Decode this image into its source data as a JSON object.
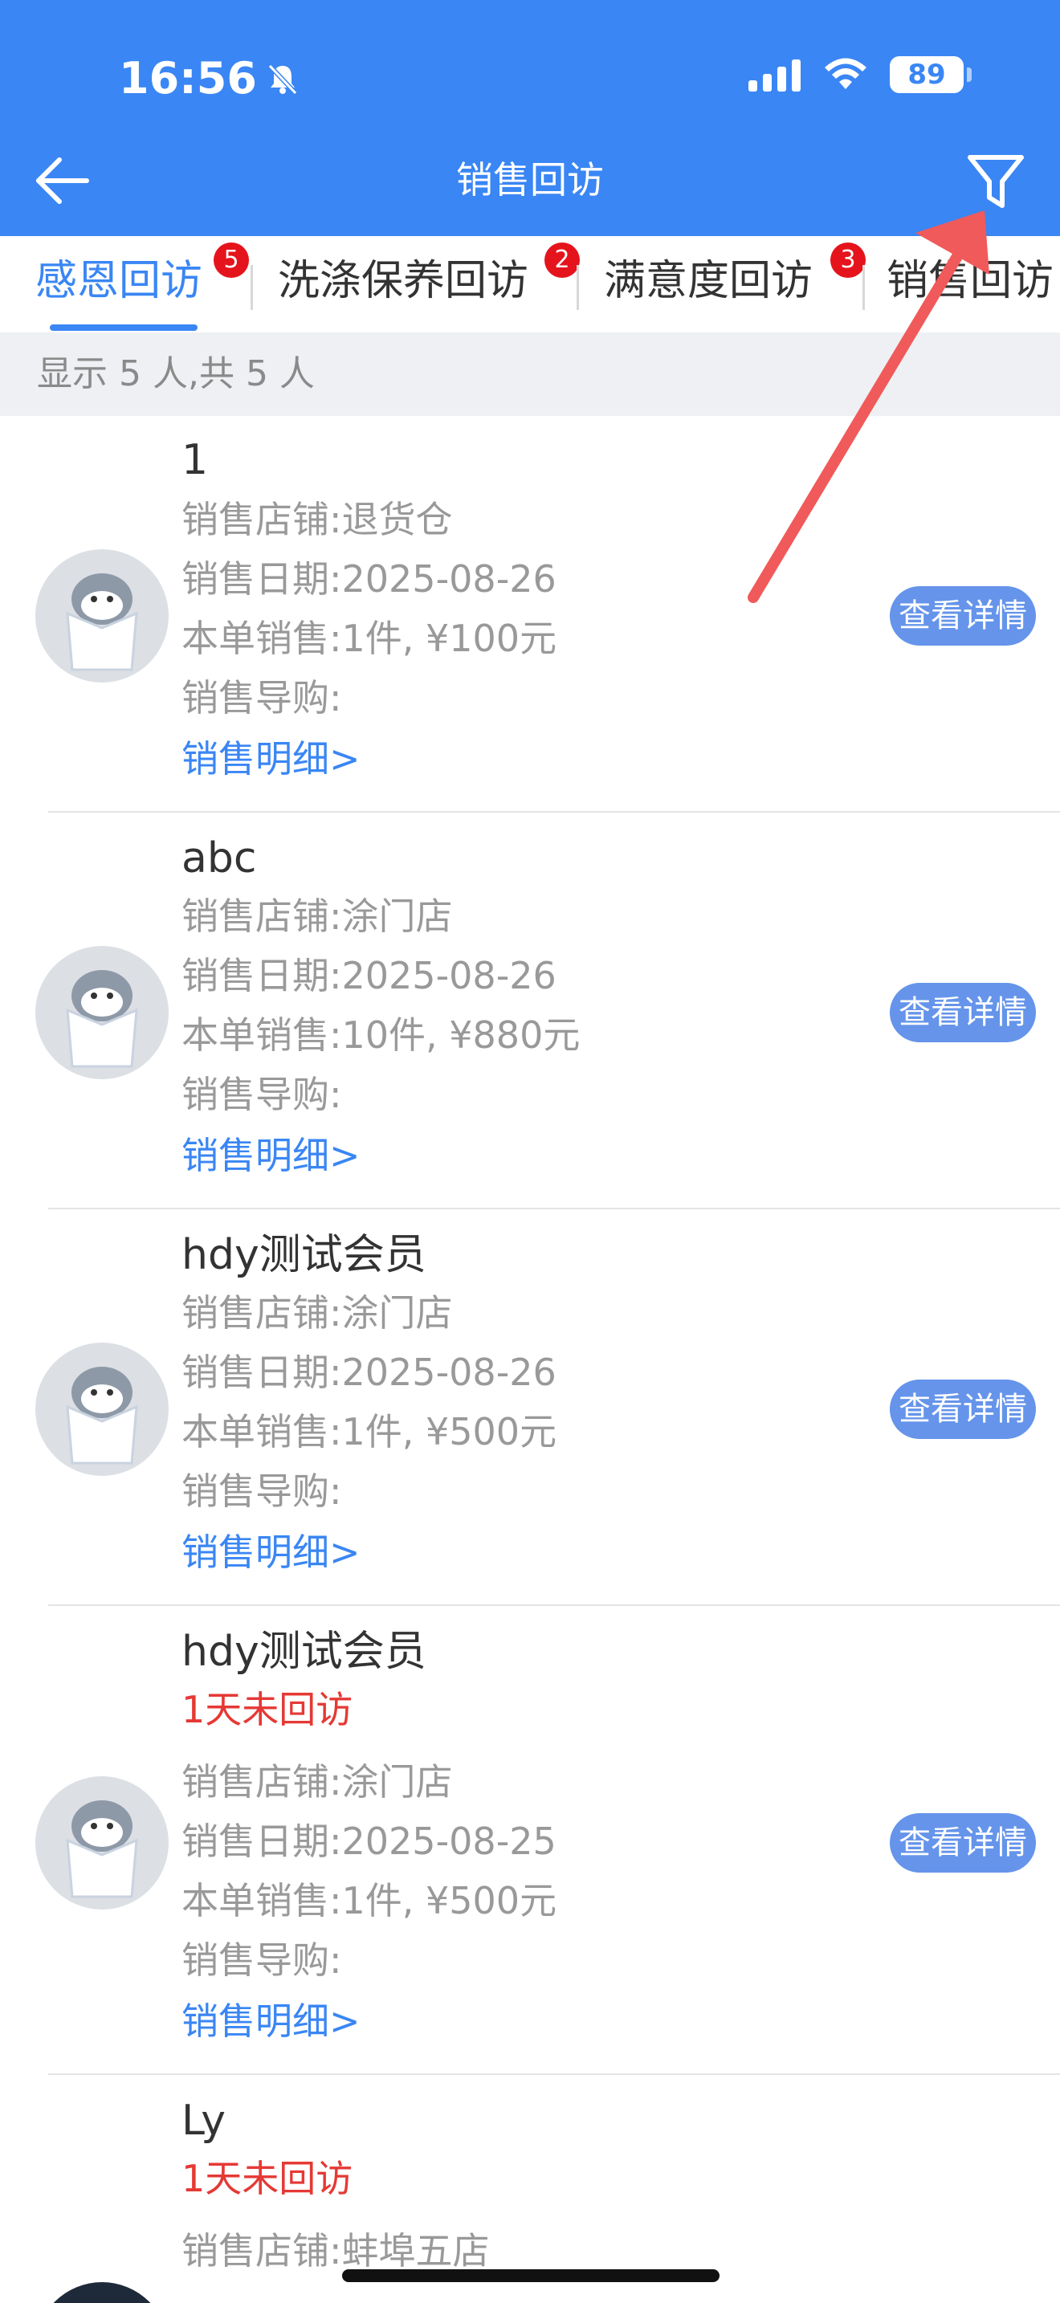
{
  "status_bar": {
    "time": "16:56",
    "battery": "89",
    "icons": [
      "mute-bell-icon",
      "cellular-signal-icon",
      "wifi-icon",
      "battery-icon"
    ]
  },
  "header": {
    "title": "销售回访",
    "back_icon": "back-arrow-icon",
    "filter_icon": "filter-funnel-icon",
    "color": "#3a86f4"
  },
  "tabs": [
    {
      "label": "感恩回访",
      "badge": "5",
      "active": true
    },
    {
      "label": "洗涤保养回访",
      "badge": "2"
    },
    {
      "label": "满意度回访",
      "badge": "3"
    },
    {
      "label": "销售回访"
    }
  ],
  "summary": "显示 5 人,共 5 人",
  "cards": [
    {
      "name": "1",
      "store": "销售店铺:退货仓",
      "date": "销售日期:2025-08-26",
      "sale": "本单销售:1件, ¥100元",
      "guide": "销售导购:",
      "link": "销售明细>",
      "button": "查看详情"
    },
    {
      "name": "abc",
      "store": "销售店铺:涂门店",
      "date": "销售日期:2025-08-26",
      "sale": "本单销售:10件, ¥880元",
      "guide": "销售导购:",
      "link": "销售明细>",
      "button": "查看详情"
    },
    {
      "name": "hdy测试会员",
      "store": "销售店铺:涂门店",
      "date": "销售日期:2025-08-26",
      "sale": "本单销售:1件, ¥500元",
      "guide": "销售导购:",
      "link": "销售明细>",
      "button": "查看详情"
    },
    {
      "name": "hdy测试会员",
      "overdue": "1天未回访",
      "store": "销售店铺:涂门店",
      "date": "销售日期:2025-08-25",
      "sale": "本单销售:1件, ¥500元",
      "guide": "销售导购:",
      "link": "销售明细>",
      "button": "查看详情"
    },
    {
      "name": "Ly",
      "overdue": "1天未回访",
      "store": "销售店铺:蚌埠五店"
    }
  ],
  "overlay": {
    "arrow_color": "#f05a5a"
  }
}
